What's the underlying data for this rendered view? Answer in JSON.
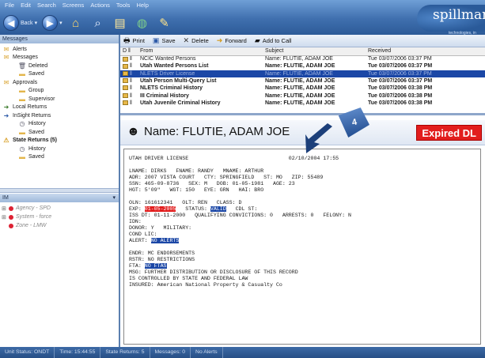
{
  "menu": [
    "File",
    "Edit",
    "Search",
    "Screens",
    "Actions",
    "Tools",
    "Help"
  ],
  "toolbar": {
    "back_label": "Back",
    "logo_text": "spillman",
    "logo_tagline": "technologies, in"
  },
  "messages_panel": {
    "title": "Messages",
    "tree": [
      {
        "label": "Alerts",
        "indent": 0,
        "icon": "alert-icon",
        "bold": false
      },
      {
        "label": "Messages",
        "indent": 0,
        "icon": "messages-icon",
        "bold": false
      },
      {
        "label": "Deleted",
        "indent": 2,
        "icon": "trash-icon",
        "bold": false
      },
      {
        "label": "Saved",
        "indent": 2,
        "icon": "folder-icon",
        "bold": false
      },
      {
        "label": "Approvals",
        "indent": 0,
        "icon": "approvals-icon",
        "bold": false
      },
      {
        "label": "Group",
        "indent": 2,
        "icon": "folder-icon",
        "bold": false
      },
      {
        "label": "Supervisor",
        "indent": 2,
        "icon": "folder-icon",
        "bold": false
      },
      {
        "label": "Local Returns",
        "indent": 0,
        "icon": "local-returns-icon",
        "bold": false
      },
      {
        "label": "InSight Returns",
        "indent": 0,
        "icon": "insight-returns-icon",
        "bold": false
      },
      {
        "label": "History",
        "indent": 2,
        "icon": "history-icon",
        "bold": false
      },
      {
        "label": "Saved",
        "indent": 2,
        "icon": "folder-icon",
        "bold": false
      },
      {
        "label": "State Returns (5)",
        "indent": 0,
        "icon": "state-returns-icon",
        "bold": true
      },
      {
        "label": "History",
        "indent": 2,
        "icon": "history-icon",
        "bold": false
      },
      {
        "label": "Saved",
        "indent": 2,
        "icon": "folder-icon",
        "bold": false
      }
    ]
  },
  "im_panel": {
    "title": "IM",
    "items": [
      "Agency - SPD",
      "System - force",
      "Zone - LMW"
    ]
  },
  "actions": [
    "Print",
    "Save",
    "Delete",
    "Forward",
    "Add to Call"
  ],
  "message_table": {
    "columns": [
      "D",
      "From",
      "Subject",
      "Received"
    ],
    "rows": [
      {
        "from": "NCIC Wanted Persons",
        "subject": "Name: FLUTIE, ADAM JOE",
        "received": "Tue 03/07/2006 03:37 PM",
        "selected": false,
        "bold": false
      },
      {
        "from": "Utah Wanted Persons List",
        "subject": "Name: FLUTIE, ADAM JOE",
        "received": "Tue 03/07/2006 03:37 PM",
        "selected": false,
        "bold": true
      },
      {
        "from": "NLETS Driver License",
        "subject": "Name: FLUTIE, ADAM JOE",
        "received": "Tue 03/07/2006 03:37 PM",
        "selected": true,
        "bold": false
      },
      {
        "from": "Utah Person Multi-Query List",
        "subject": "Name: FLUTIE, ADAM JOE",
        "received": "Tue 03/07/2006 03:37 PM",
        "selected": false,
        "bold": true
      },
      {
        "from": "NLETS Criminal History",
        "subject": "Name: FLUTIE, ADAM JOE",
        "received": "Tue 03/07/2006 03:38 PM",
        "selected": false,
        "bold": true
      },
      {
        "from": "III Criminal History",
        "subject": "Name: FLUTIE, ADAM JOE",
        "received": "Tue 03/07/2006 03:38 PM",
        "selected": false,
        "bold": true
      },
      {
        "from": "Utah Juvenile Criminal History",
        "subject": "Name: FLUTIE, ADAM JOE",
        "received": "Tue 03/07/2006 03:38 PM",
        "selected": false,
        "bold": true
      }
    ]
  },
  "detail": {
    "name": "Name: FLUTIE, ADAM JOE",
    "status_badge": "Expired DL",
    "callout_number": "4",
    "doc_lines": [
      "UTAH DRIVER LICENSE                                02/10/2004 17:55",
      "",
      "LNAME: DIRKS   FNAME: RANDY   MNAME: ARTHUR",
      "ADR: 2007 VISTA COURT   CTY: SPRINGFIELD   ST: MO   ZIP: 55489",
      "SSN: 465-09-8736   SEX: M   DOB: 01-05-1981   AGE: 23",
      "HGT: 5'09\"   WGT: 150   EYE: GRN   HAI: BRO",
      "",
      "OLN: 161612341   OLT: REN   CLASS: D",
      "EXP: |01-05-2005|   STATUS: |VALID|   CDL ST:",
      "ISS DT: 01-11-2000   QUALIFYING CONVICTIONS: 0   ARRESTS: 0   FELONY: N",
      "IDN:",
      "DONOR: Y   MILITARY:",
      "COND LIC:",
      "ALERT: |NO ALERTS|",
      "",
      "ENDR: MC ENDORSEMENTS",
      "RSTR: NO RESTRICTIONS",
      "FTA: |NO FTAS|",
      "MSG: FURTHER DISTRIBUTION OR DISCLOSURE OF THIS RECORD",
      "IS CONTROLLED BY STATE AND FEDERAL LAW",
      "INSURED: American National Property & Casualty Co"
    ],
    "exp_date": "01-05-2005",
    "status_value": "VALID",
    "alert_value": "NO ALERTS",
    "fta_value": "NO FTAS",
    "colors": {
      "expired": "#e21d1d",
      "highlight_blue": "#1b47a6"
    }
  },
  "status_bar": [
    "Unit Status: ONDT",
    "Time: 15:44:55",
    "State Returns: 5",
    "Messages: 0",
    "No Alerts"
  ]
}
